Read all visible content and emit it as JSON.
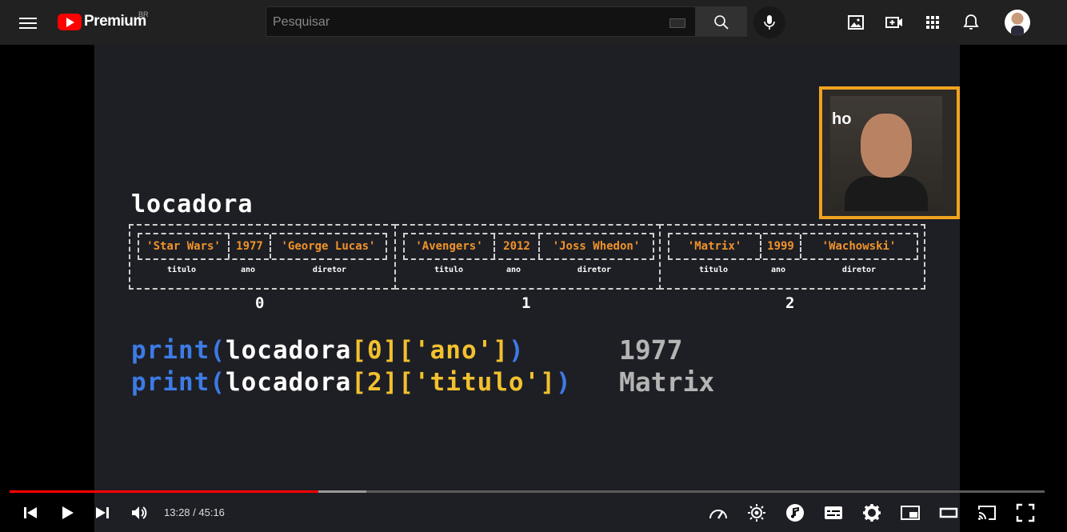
{
  "masthead": {
    "logo_text": "Premium",
    "country": "BR",
    "search_placeholder": "Pesquisar"
  },
  "slide": {
    "dict_name": "locadora",
    "records": [
      {
        "index": "0",
        "values": [
          "'Star Wars'",
          "1977",
          "'George Lucas'"
        ],
        "keys": [
          "titulo",
          "ano",
          "diretor"
        ]
      },
      {
        "index": "1",
        "values": [
          "'Avengers'",
          "2012",
          "'Joss Whedon'"
        ],
        "keys": [
          "titulo",
          "ano",
          "diretor"
        ]
      },
      {
        "index": "2",
        "values": [
          "'Matrix'",
          "1999",
          "'Wachowski'"
        ],
        "keys": [
          "titulo",
          "ano",
          "diretor"
        ]
      }
    ],
    "code": [
      {
        "fn": "print(",
        "var": "locadora",
        "sub": "[0]['ano']",
        "close": ")",
        "output": "1977"
      },
      {
        "fn": "print(",
        "var": "locadora",
        "sub": "[2]['titulo']",
        "close": ")",
        "output": "Matrix"
      }
    ],
    "cam_text": "ho"
  },
  "player": {
    "time": "13:28 / 45:16",
    "progress_fraction": 0.298,
    "buffer_fraction": 0.345
  },
  "colors": {
    "accent": "#ff0000",
    "value_orange": "#f0932b",
    "code_blue": "#3d7be6",
    "code_yellow": "#f2c12e"
  }
}
